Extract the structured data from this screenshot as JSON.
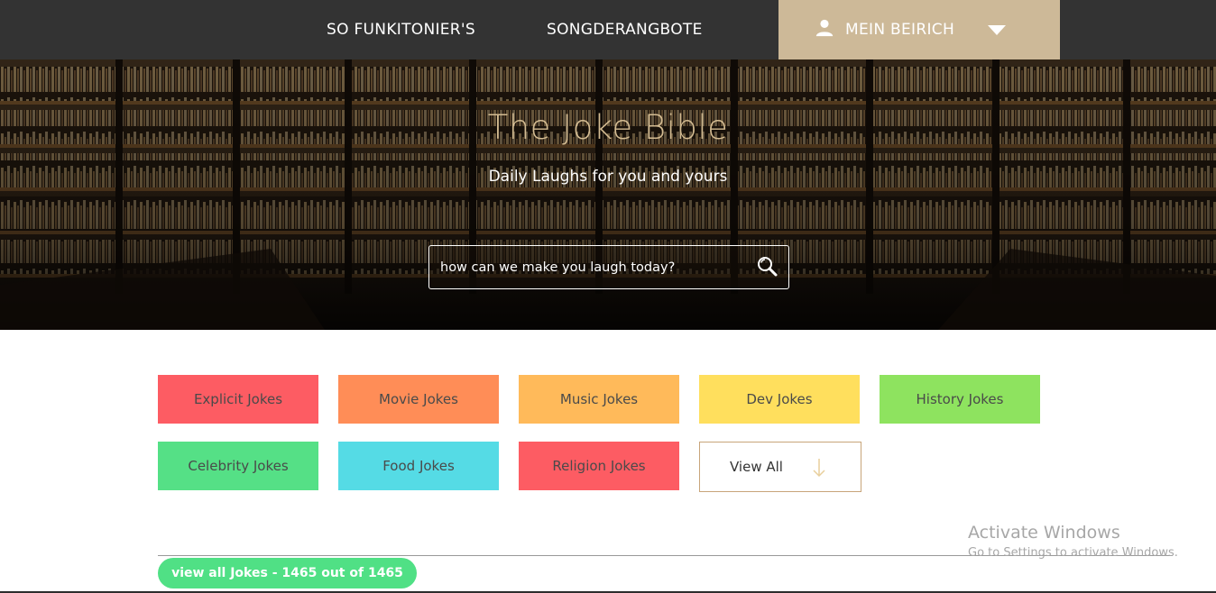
{
  "nav": {
    "links": [
      "SO FUNKITONIER'S",
      "SONGDERANGBOTE"
    ],
    "account_label": "MEIN BEIRICH"
  },
  "hero": {
    "title": "The Joke Bible",
    "subtitle": "Daily Laughs for you and yours",
    "search_placeholder": "how can we make you laugh today?"
  },
  "categories": [
    {
      "label": "Explicit Jokes",
      "color": "#fd5c63"
    },
    {
      "label": "Movie Jokes",
      "color": "#ff8d57"
    },
    {
      "label": "Music Jokes",
      "color": "#ffba5a"
    },
    {
      "label": "Dev Jokes",
      "color": "#ffdf5d"
    },
    {
      "label": "History Jokes",
      "color": "#8ee35f"
    },
    {
      "label": "Celebrity Jokes",
      "color": "#55e086"
    },
    {
      "label": "Food Jokes",
      "color": "#55dbe5"
    },
    {
      "label": "Religion Jokes",
      "color": "#fd5c63"
    }
  ],
  "view_all_label": "View All",
  "all_jokes_label": "view all Jokes - 1465 out of 1465",
  "watermark": {
    "title": "Activate Windows",
    "subtitle": "Go to Settings to activate Windows."
  },
  "colors": {
    "nav_bg": "#333333",
    "accent_gold": "#cdb998",
    "pill_green": "#50e085"
  }
}
